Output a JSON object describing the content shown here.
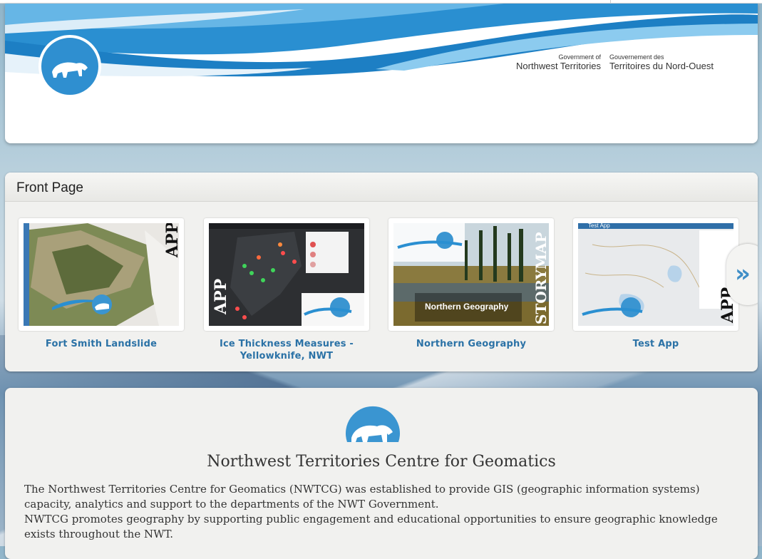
{
  "header": {
    "gov_en_small": "Government of",
    "gov_en_big": "Northwest Territories",
    "gov_fr_small": "Gouvernement des",
    "gov_fr_big": "Territoires du Nord-Ouest"
  },
  "gallery": {
    "title": "Front Page",
    "items": [
      {
        "title": "Fort Smith Landslide",
        "badge": "APP"
      },
      {
        "title": "Ice Thickness Measures - Yellowknife, NWT",
        "badge": "APP"
      },
      {
        "title": "Northern Geography",
        "badge": "STORYMAP",
        "thumb_caption": "Northern Geography"
      },
      {
        "title": "Test App",
        "badge": "APP",
        "thumb_caption": "Test App"
      }
    ],
    "next_label": "»"
  },
  "about": {
    "title": "Northwest Territories Centre for Geomatics",
    "paragraph1": "The Northwest Territories Centre for Geomatics (NWTCG) was established to provide GIS (geographic information systems) capacity, analytics and support to the departments of the NWT Government.",
    "paragraph2": "NWTCG promotes geography by supporting public engagement and educational opportunities to ensure geographic knowledge exists throughout the NWT."
  },
  "colors": {
    "brand_blue": "#2b72a6",
    "logo_blue": "#3a95d1"
  },
  "icons": {
    "logo": "polar-bear-icon",
    "next": "chevron-double-right-icon"
  }
}
